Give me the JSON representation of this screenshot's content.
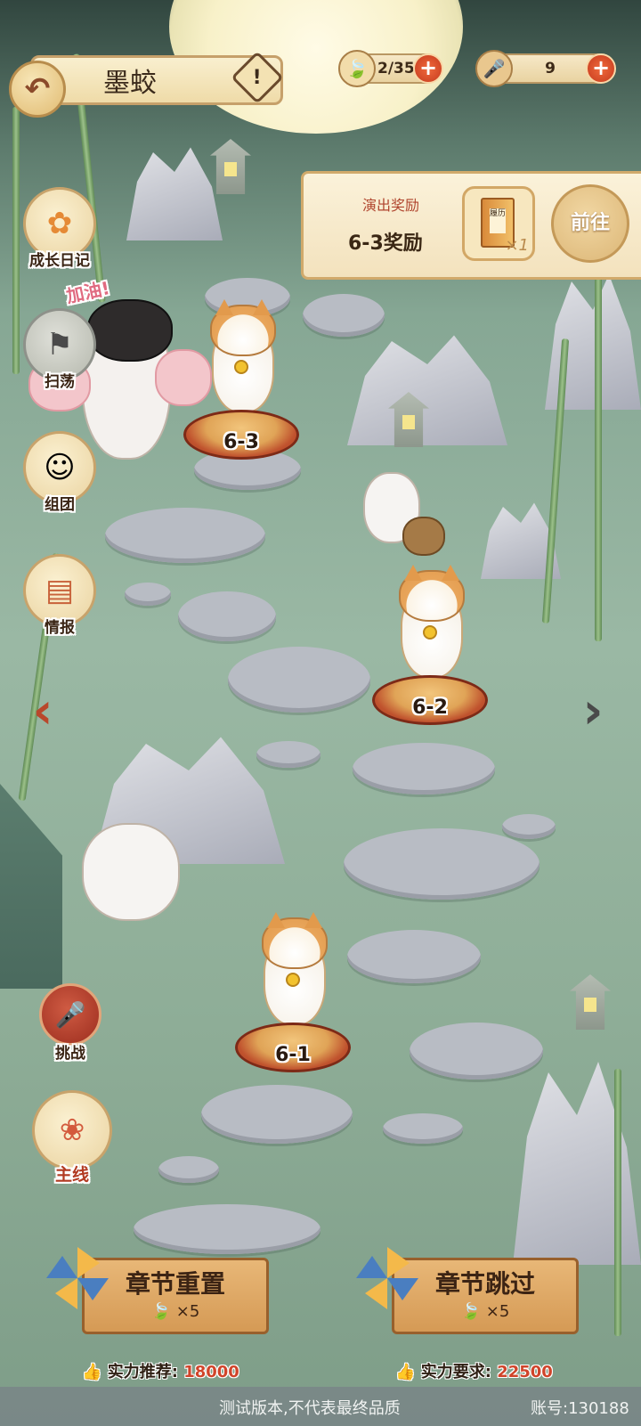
{
  "header": {
    "back_icon": "back-arrow-icon",
    "title": "墨蛟",
    "info_icon": "exclamation-icon"
  },
  "resources": [
    {
      "icon": "leaf-icon",
      "value": "2/35",
      "plus": "+"
    },
    {
      "icon": "microphone-icon",
      "value": "9",
      "plus": "+"
    }
  ],
  "side_menu": [
    {
      "icon": "flower-icon",
      "label": "成长日记"
    },
    {
      "icon": "flag-icon",
      "label": "扫荡"
    },
    {
      "icon": "girl-face-icon",
      "label": "组团"
    },
    {
      "icon": "book-icon",
      "label": "情报"
    }
  ],
  "dog_bubble": "加油!",
  "reward_panel": {
    "title": "演出奖励",
    "name": "6-3奖励",
    "item_label": "履历",
    "item_count": "×1",
    "go_label": "前往"
  },
  "stages": [
    {
      "label": "6-3"
    },
    {
      "label": "6-2"
    },
    {
      "label": "6-1"
    }
  ],
  "nav": {
    "prev_icon": "chevron-left-icon",
    "next_icon": "chevron-right-icon"
  },
  "bottom_menu": [
    {
      "icon": "microphone-sparkle-icon",
      "label": "挑战"
    },
    {
      "icon": "flower-paw-icon",
      "label": "主线"
    }
  ],
  "actions": [
    {
      "label": "章节重置",
      "cost": "×5",
      "power_label": "实力推荐:",
      "power_value": "18000"
    },
    {
      "label": "章节跳过",
      "cost": "×5",
      "power_label": "实力要求:",
      "power_value": "22500"
    }
  ],
  "footer": {
    "notice": "测试版本,不代表最终品质",
    "account": "账号:130188"
  },
  "colors": {
    "accent_red": "#d0442a",
    "gold": "#c6a06a",
    "background": "#8fae98"
  }
}
